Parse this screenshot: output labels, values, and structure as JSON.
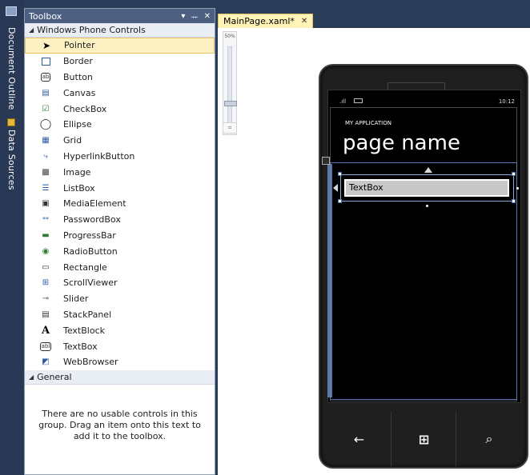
{
  "side_tabs": {
    "document_outline": "Document Outline",
    "data_sources": "Data Sources"
  },
  "toolbox": {
    "title": "Toolbox",
    "dropdown_icon": "▾",
    "pin_icon": "ᅲ",
    "close_icon": "✕",
    "groups": [
      {
        "label": "Windows Phone Controls",
        "items": [
          {
            "label": "Pointer",
            "icon": "pointer"
          },
          {
            "label": "Border",
            "icon": "border"
          },
          {
            "label": "Button",
            "icon": "button"
          },
          {
            "label": "Canvas",
            "icon": "canvas"
          },
          {
            "label": "CheckBox",
            "icon": "checkbox"
          },
          {
            "label": "Ellipse",
            "icon": "ellipse"
          },
          {
            "label": "Grid",
            "icon": "grid"
          },
          {
            "label": "HyperlinkButton",
            "icon": "hyperlink"
          },
          {
            "label": "Image",
            "icon": "image"
          },
          {
            "label": "ListBox",
            "icon": "listbox"
          },
          {
            "label": "MediaElement",
            "icon": "media"
          },
          {
            "label": "PasswordBox",
            "icon": "password"
          },
          {
            "label": "ProgressBar",
            "icon": "progress"
          },
          {
            "label": "RadioButton",
            "icon": "radio"
          },
          {
            "label": "Rectangle",
            "icon": "rectangle"
          },
          {
            "label": "ScrollViewer",
            "icon": "scroll"
          },
          {
            "label": "Slider",
            "icon": "slider"
          },
          {
            "label": "StackPanel",
            "icon": "stackpanel"
          },
          {
            "label": "TextBlock",
            "icon": "textblock"
          },
          {
            "label": "TextBox",
            "icon": "textbox"
          },
          {
            "label": "WebBrowser",
            "icon": "webbrowser"
          }
        ]
      },
      {
        "label": "General",
        "empty_message": "There are no usable controls in this group. Drag an item onto this text to add it to the toolbox."
      }
    ]
  },
  "editor": {
    "tab_label": "MainPage.xaml*",
    "tab_close": "✕",
    "zoom_label": "50%",
    "zoom_level": 0.5
  },
  "phone": {
    "status_time": "10:12",
    "status_signal": ".ıll",
    "app_title": "MY APPLICATION",
    "page_title": "page name",
    "textbox_value": "TextBox",
    "nav_back": "←",
    "nav_start": "⊞",
    "nav_search": "⌕"
  },
  "colors": {
    "ide_background": "#2b3c59",
    "toolbox_title_bar": "#4d6082",
    "selected_item": "#fdf0c2",
    "phone_bezel": "#1f1f1f",
    "selection_outline": "#6f8ec7"
  }
}
